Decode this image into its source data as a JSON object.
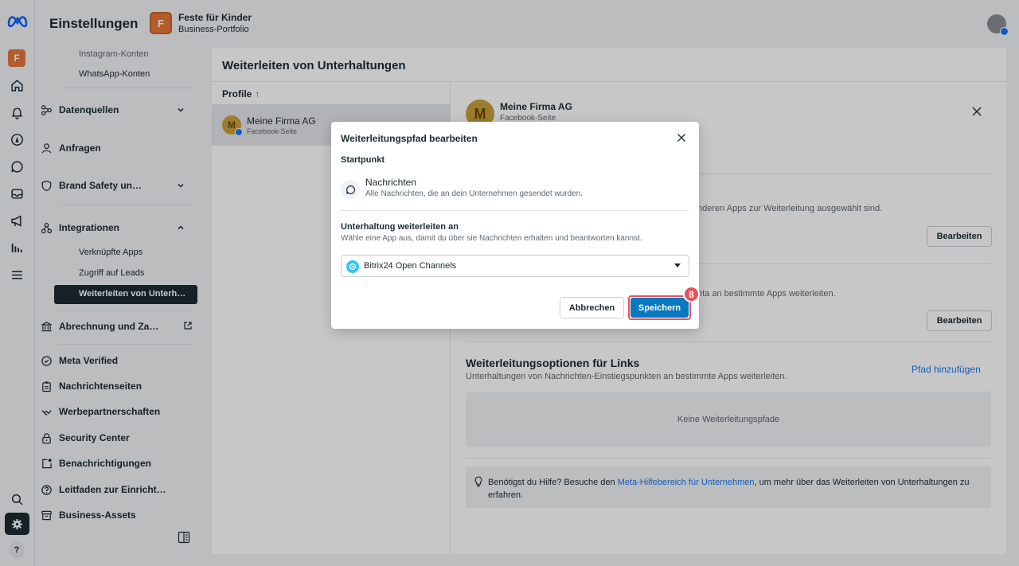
{
  "app": {
    "title": "Einstellungen",
    "business": {
      "initial": "F",
      "name": "Feste für Kinder",
      "type": "Business-Portfolio"
    }
  },
  "rail": {
    "account_initial": "F",
    "icons": [
      "meta-logo-icon",
      "home-icon",
      "bell-icon",
      "compass-icon",
      "chat-icon",
      "inbox-icon",
      "megaphone-icon",
      "chart-icon",
      "menu-icon",
      "search-icon",
      "gear-icon",
      "help-icon"
    ],
    "help_label": "?"
  },
  "sidebar": {
    "top_items": [
      "Instagram-Konten",
      "WhatsApp-Konten"
    ],
    "datenquellen": "Datenquellen",
    "anfragen": "Anfragen",
    "brand_safety": "Brand Safety un…",
    "integrationen": "Integrationen",
    "integration_subs": [
      "Verknüpfte Apps",
      "Zugriff auf Leads"
    ],
    "active_item": "Weiterleiten von Unterh…",
    "abrechnung": "Abrechnung und Za…",
    "bottom_items": [
      "Meta Verified",
      "Nachrichtenseiten",
      "Werbepartnerschaften",
      "Security Center",
      "Benachrichtigungen",
      "Leitfaden zur Einricht…",
      "Business-Assets"
    ]
  },
  "main": {
    "title": "Weiterleiten von Unterhaltungen",
    "profiles_header": "Profile",
    "sort_arrow": "↑",
    "profile": {
      "initial": "M",
      "name": "Meine Firma AG",
      "type": "Facebook-Seite"
    },
    "detail": {
      "name": "Meine Firma AG",
      "type": "Facebook-Seite",
      "text_1": "nderen Apps zur Weiterleitung ausgewählt sind.",
      "text_2": "eta an bestimmte Apps weiterleiten.",
      "edit_label": "Bearbeiten",
      "links_title": "Weiterleitungsoptionen für Links",
      "links_sub": "Unterhaltungen von Nachrichten-Einstiegspunkten an bestimmte Apps weiterleiten.",
      "add_path": "Pfad hinzufügen",
      "empty": "Keine Weiterleitungspfade",
      "help_before": "Benötigst du Hilfe? Besuche den ",
      "help_link": "Meta-Hilfebereich für Unternehmen",
      "help_after": ", um mehr über das Weiterleiten von Unterhaltungen zu erfahren."
    }
  },
  "modal": {
    "title": "Weiterleitungspfad bearbeiten",
    "start_label": "Startpunkt",
    "start_title": "Nachrichten",
    "start_sub": "Alle Nachrichten, die an dein Unternehmen gesendet wurden.",
    "forward_title": "Unterhaltung weiterleiten an",
    "forward_sub": "Wähle eine App aus, damit du über sie Nachrichten erhalten und beantworten kannst.",
    "selected_app": "Bitrix24 Open Channels",
    "cancel": "Abbrechen",
    "save": "Speichern",
    "step_badge": "8"
  },
  "colors": {
    "accent": "#1877f2",
    "save": "#0a78be",
    "highlight": "#e8505b",
    "brand_orange": "#e8773a"
  }
}
